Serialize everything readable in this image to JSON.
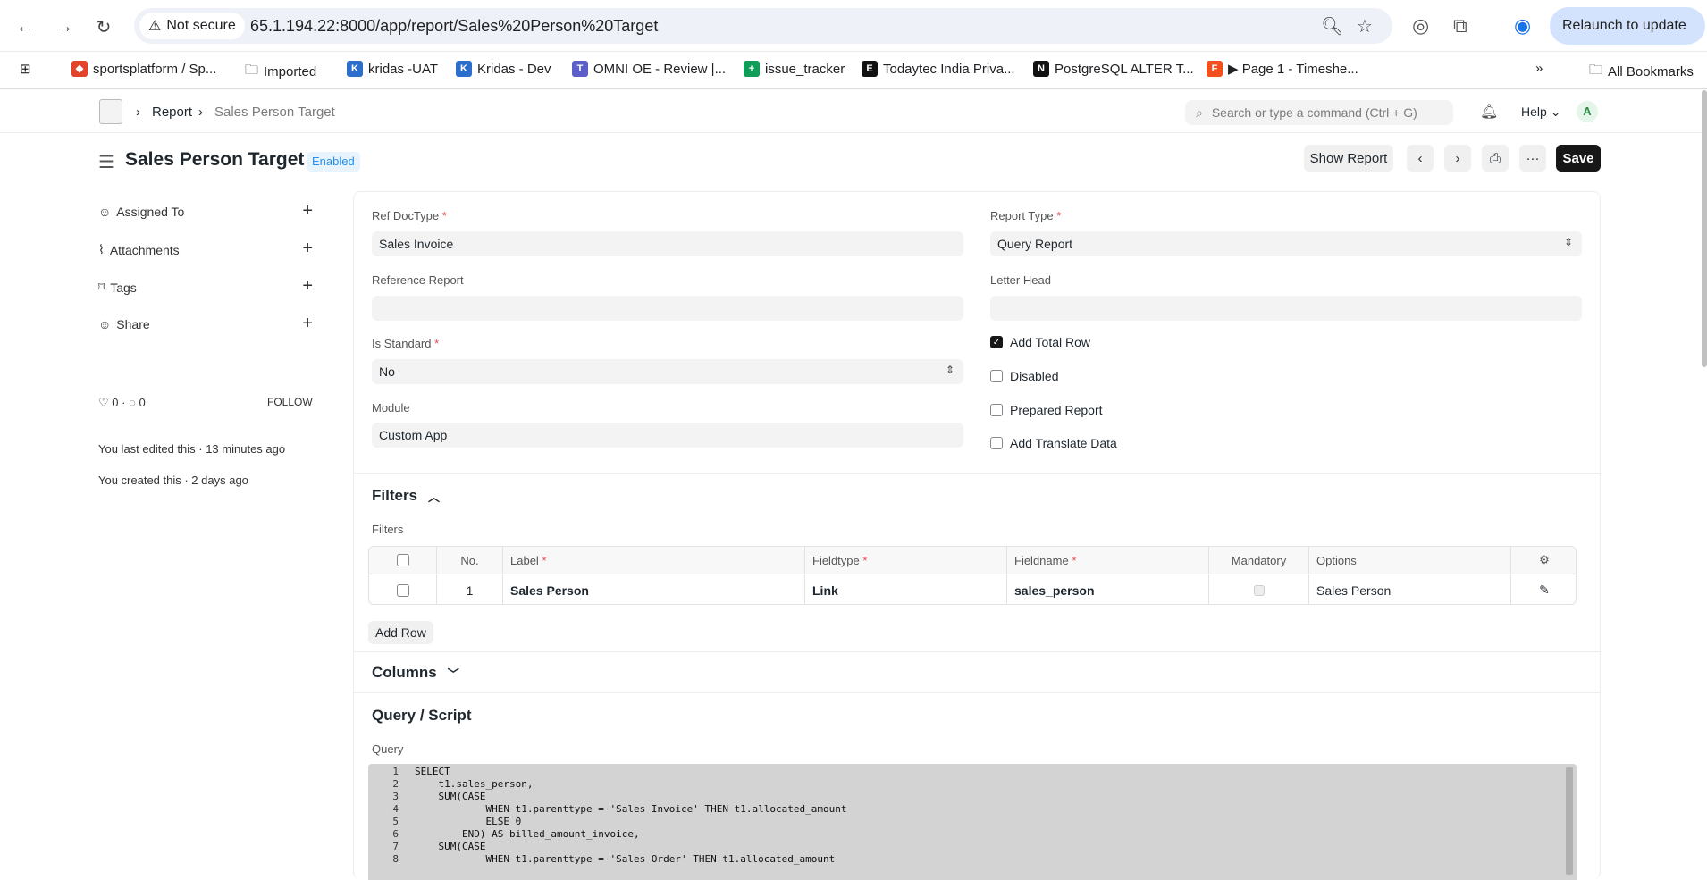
{
  "browser": {
    "not_secure": "Not secure",
    "url": "65.1.194.22:8000/app/report/Sales%20Person%20Target",
    "relaunch": "Relaunch to update",
    "bookmarks": [
      {
        "label": "sportsplatform / Sp...",
        "color": "#e2432a"
      },
      {
        "label": "Imported",
        "color": "#555555"
      },
      {
        "label": "kridas -UAT",
        "color": "#2c6ecb"
      },
      {
        "label": "Kridas - Dev",
        "color": "#2c6ecb"
      },
      {
        "label": "OMNI OE - Review |...",
        "color": "#5b5fc7"
      },
      {
        "label": "issue_tracker",
        "color": "#0f9d58"
      },
      {
        "label": "Todaytec India Priva...",
        "color": "#111111"
      },
      {
        "label": "PostgreSQL ALTER T...",
        "color": "#111111"
      },
      {
        "label": "▶ Page 1 - Timeshe...",
        "color": "#f24e1e"
      }
    ],
    "all_bookmarks": "All Bookmarks"
  },
  "app": {
    "breadcrumb": [
      "Report",
      "Sales Person Target"
    ],
    "search_placeholder": "Search or type a command (Ctrl + G)",
    "help": "Help",
    "avatar": "A"
  },
  "page": {
    "title": "Sales Person Target",
    "status": "Enabled",
    "show_report": "Show Report",
    "save": "Save"
  },
  "sidebar": {
    "items": [
      {
        "label": "Assigned To",
        "icon": "user-icon"
      },
      {
        "label": "Attachments",
        "icon": "paperclip-icon"
      },
      {
        "label": "Tags",
        "icon": "tag-icon"
      },
      {
        "label": "Share",
        "icon": "share-icon"
      }
    ],
    "likes": "0",
    "comments": "0",
    "follow": "FOLLOW",
    "last_edited": "You last edited this · 13 minutes ago",
    "created": "You created this · 2 days ago"
  },
  "form": {
    "ref_doctype_label": "Ref DocType",
    "ref_doctype_value": "Sales Invoice",
    "report_type_label": "Report Type",
    "report_type_value": "Query Report",
    "reference_report_label": "Reference Report",
    "letter_head_label": "Letter Head",
    "is_standard_label": "Is Standard",
    "is_standard_value": "No",
    "module_label": "Module",
    "module_value": "Custom App",
    "checks": [
      {
        "label": "Add Total Row",
        "checked": true
      },
      {
        "label": "Disabled",
        "checked": false
      },
      {
        "label": "Prepared Report",
        "checked": false
      },
      {
        "label": "Add Translate Data",
        "checked": false
      }
    ]
  },
  "filters": {
    "section": "Filters",
    "table_label": "Filters",
    "headers": {
      "no": "No.",
      "label": "Label",
      "fieldtype": "Fieldtype",
      "fieldname": "Fieldname",
      "mandatory": "Mandatory",
      "options": "Options"
    },
    "rows": [
      {
        "no": "1",
        "label": "Sales Person",
        "fieldtype": "Link",
        "fieldname": "sales_person",
        "options": "Sales Person"
      }
    ],
    "add_row": "Add Row"
  },
  "columns_section": "Columns",
  "query_section": "Query / Script",
  "query_label": "Query",
  "query_lines": [
    "SELECT",
    "    t1.sales_person,",
    "    SUM(CASE",
    "            WHEN t1.parenttype = 'Sales Invoice' THEN t1.allocated_amount",
    "            ELSE 0",
    "        END) AS billed_amount_invoice,",
    "    SUM(CASE",
    "            WHEN t1.parenttype = 'Sales Order' THEN t1.allocated_amount"
  ]
}
